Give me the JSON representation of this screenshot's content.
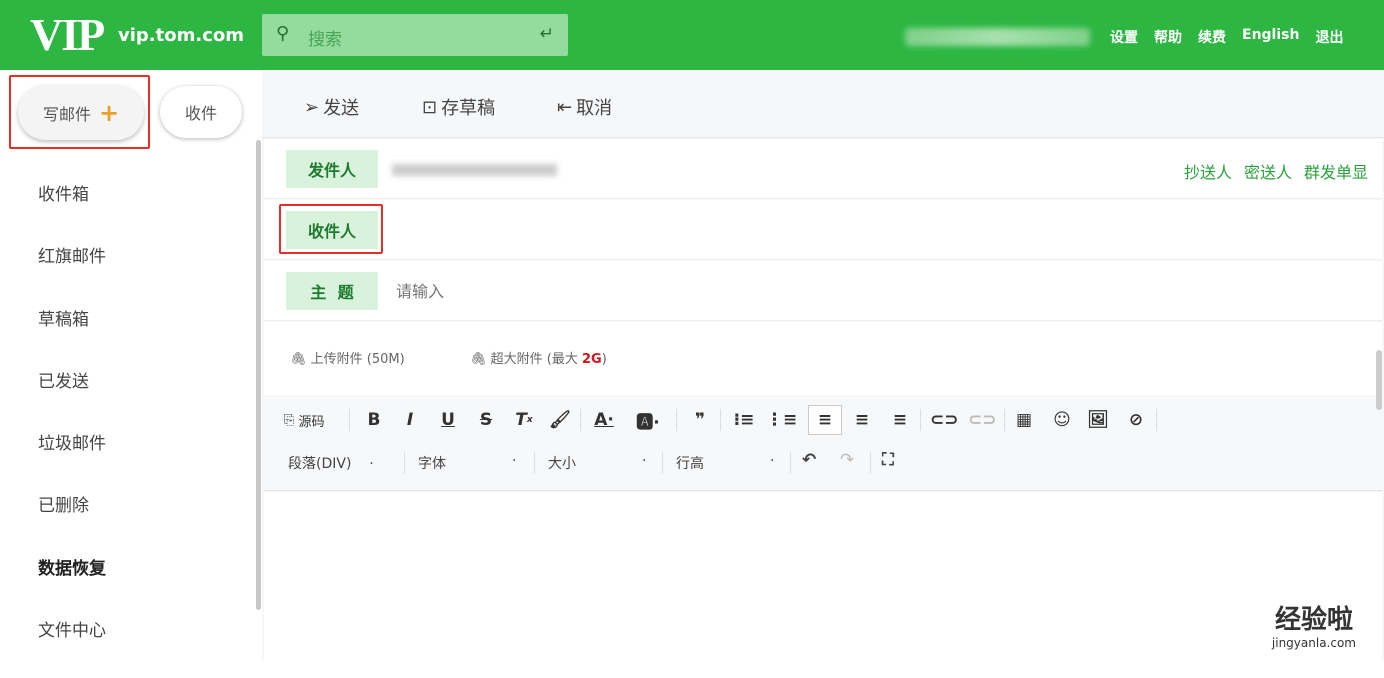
{
  "header": {
    "logo": "VIP",
    "domain": "vip.tom.com",
    "search_placeholder": "搜索",
    "links": [
      "设置",
      "帮助",
      "续费",
      "English",
      "退出"
    ]
  },
  "sidebar": {
    "compose": "写邮件",
    "receive": "收件",
    "folders": [
      "收件箱",
      "红旗邮件",
      "草稿箱",
      "已发送",
      "垃圾邮件",
      "已删除",
      "数据恢复",
      "文件中心"
    ]
  },
  "toolbar": {
    "send": "发送",
    "draft": "存草稿",
    "cancel": "取消"
  },
  "form": {
    "from_label": "发件人",
    "to_label": "收件人",
    "subject_label": "主  题",
    "subject_placeholder": "请输入",
    "cc": "抄送人",
    "bcc": "密送人",
    "separate": "群发单显"
  },
  "attachments": {
    "upload": "上传附件",
    "upload_limit": "(50M)",
    "large": "超大附件",
    "large_prefix": "(最大",
    "large_size": "2G",
    "large_suffix": ")"
  },
  "editor": {
    "source": "源码",
    "paragraph": "段落(DIV)",
    "font": "字体",
    "size": "大小",
    "line_height": "行高"
  },
  "watermark": {
    "text": "经验啦",
    "url": "jingyanla.com"
  },
  "colors": {
    "brand": "#2db742",
    "highlight": "#e0302a"
  }
}
